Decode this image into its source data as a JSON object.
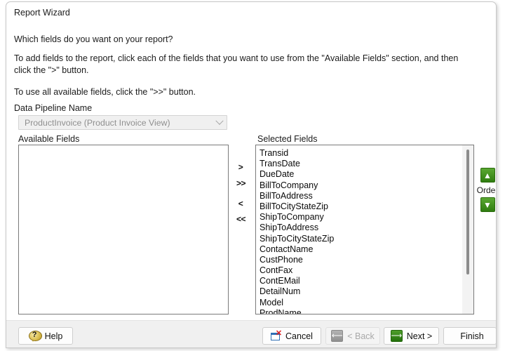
{
  "window": {
    "title": "Report Wizard"
  },
  "content": {
    "question": "Which fields do you want on your report?",
    "instruction_1": "To add fields to the report, click each of the fields that you want to use from the \"Available Fields\" section, and then click the \">\" button.",
    "instruction_2": "To use all available fields, click the \">>\" button."
  },
  "data_pipeline": {
    "label": "Data Pipeline Name",
    "value": "ProductInvoice  (Product Invoice View)",
    "disabled": true,
    "dropdown_icon": "chevron-down-icon"
  },
  "available_fields": {
    "label": "Available Fields",
    "items": []
  },
  "selected_fields": {
    "label": "Selected Fields",
    "items": [
      "Transid",
      "TransDate",
      "DueDate",
      "BillToCompany",
      "BillToAddress",
      "BillToCityStateZip",
      "ShipToCompany",
      "ShipToAddress",
      "ShipToCityStateZip",
      "ContactName",
      "CustPhone",
      "ContFax",
      "ContEMail",
      "DetailNum",
      "Model",
      "ProdName"
    ]
  },
  "transfer_buttons": {
    "add": ">",
    "add_all": ">>",
    "remove": "<",
    "remove_all": "<<"
  },
  "order": {
    "label": "Order",
    "up_icon": "arrow-up-icon",
    "down_icon": "arrow-down-icon",
    "accent_color": "#2f7d10"
  },
  "footer": {
    "help": {
      "label": "Help",
      "icon": "help-bubble-icon"
    },
    "cancel": {
      "label": "Cancel",
      "icon": "cancel-window-icon"
    },
    "back": {
      "label": "< Back",
      "icon": "arrow-left-icon",
      "disabled": true
    },
    "next": {
      "label": "Next >",
      "icon": "arrow-right-icon"
    },
    "finish": {
      "label": "Finish"
    }
  }
}
